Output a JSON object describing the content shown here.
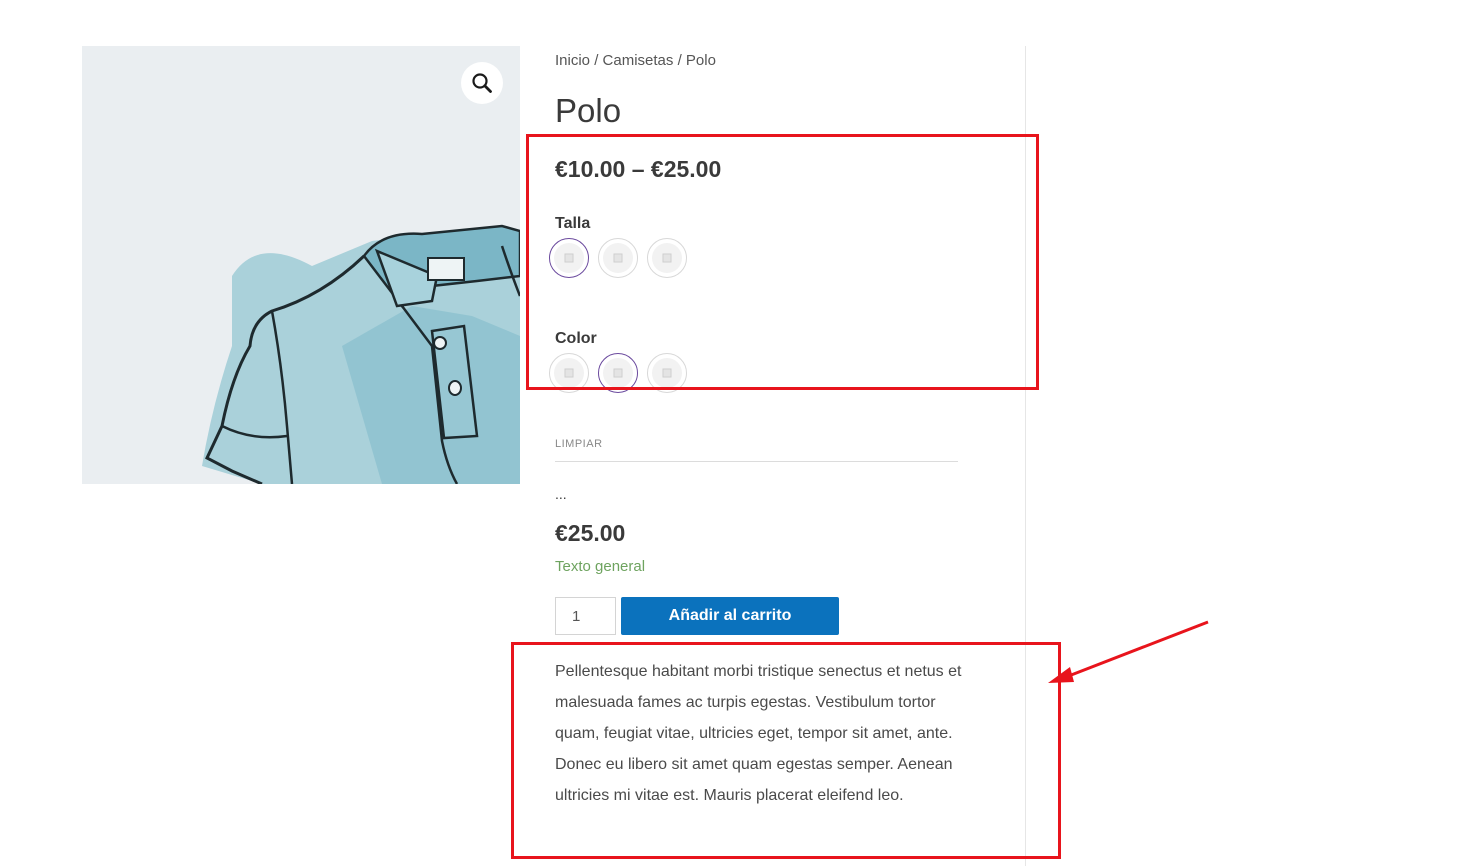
{
  "breadcrumb": {
    "home": "Inicio",
    "sep1": "/",
    "category": "Camisetas",
    "sep2": "/",
    "current": "Polo"
  },
  "product": {
    "title": "Polo",
    "price_range": "€10.00 – €25.00",
    "attributes": [
      {
        "label": "Talla",
        "options_count": 3,
        "selected_index": 0
      },
      {
        "label": "Color",
        "options_count": 3,
        "selected_index": 1
      }
    ],
    "clear_label": "LIMPIAR",
    "ellipsis": "...",
    "variation_price": "€25.00",
    "stock_text": "Texto general",
    "quantity": "1",
    "add_to_cart_label": "Añadir al carrito",
    "description": "Pellentesque habitant morbi tristique senectus et netus et malesuada fames ac turpis egestas. Vestibulum tortor quam, feugiat vitae, ultricies eget, tempor sit amet, ante. Donec eu libero sit amet quam egestas semper. Aenean ultricies mi vitae est. Mauris placerat eleifend leo."
  },
  "gallery": {
    "zoom_icon": "magnifier-icon",
    "image_subject": "polo-shirt-illustration"
  },
  "colors": {
    "accent_button": "#0b72bd",
    "stock_green": "#6ea35f",
    "annotation_red": "#e8141c",
    "swatch_selected": "#6b4a9e",
    "gallery_bg": "#eaeef1"
  }
}
